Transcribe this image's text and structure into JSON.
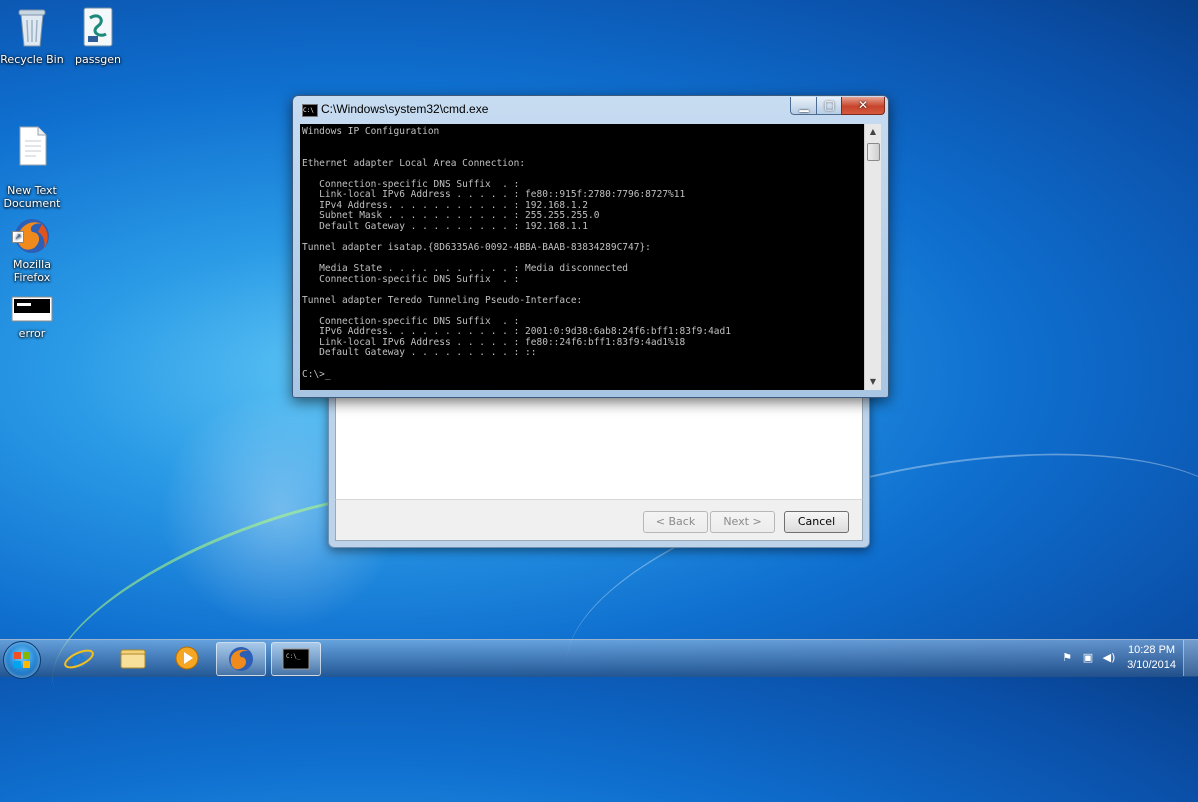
{
  "desktop": {
    "icons": [
      {
        "label": "Recycle Bin"
      },
      {
        "label": "passgen"
      },
      {
        "label": "New Text\nDocument"
      },
      {
        "label": "Mozilla\nFirefox"
      },
      {
        "label": "error"
      }
    ]
  },
  "cmd": {
    "title": "C:\\Windows\\system32\\cmd.exe",
    "output": "Windows IP Configuration\n\n\nEthernet adapter Local Area Connection:\n\n   Connection-specific DNS Suffix  . :\n   Link-local IPv6 Address . . . . . : fe80::915f:2780:7796:8727%11\n   IPv4 Address. . . . . . . . . . . : 192.168.1.2\n   Subnet Mask . . . . . . . . . . . : 255.255.255.0\n   Default Gateway . . . . . . . . . : 192.168.1.1\n\nTunnel adapter isatap.{8D6335A6-0092-4BBA-BAAB-83834289C747}:\n\n   Media State . . . . . . . . . . . : Media disconnected\n   Connection-specific DNS Suffix  . :\n\nTunnel adapter Teredo Tunneling Pseudo-Interface:\n\n   Connection-specific DNS Suffix  . :\n   IPv6 Address. . . . . . . . . . . : 2001:0:9d38:6ab8:24f6:bff1:83f9:4ad1\n   Link-local IPv6 Address . . . . . : fe80::24f6:bff1:83f9:4ad1%18\n   Default Gateway . . . . . . . . . : ::\n\nC:\\>_",
    "minimize_icon": "minimize-icon",
    "maximize_icon": "maximize-icon",
    "close_icon": "close-icon"
  },
  "wizard": {
    "back_label": "< Back",
    "next_label": "Next >",
    "cancel_label": "Cancel"
  },
  "taskbar": {
    "pinned": [
      "internet-explorer-icon",
      "windows-explorer-icon",
      "media-player-icon",
      "firefox-icon",
      "cmd-icon"
    ],
    "clock_time": "10:28 PM",
    "clock_date": "3/10/2014"
  }
}
